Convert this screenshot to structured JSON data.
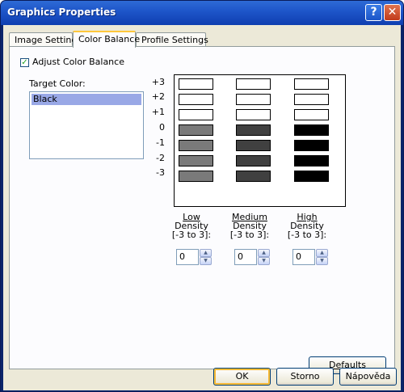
{
  "window": {
    "title": "Graphics Properties",
    "help_glyph": "?",
    "close_glyph": "✕"
  },
  "tabs": [
    {
      "label": "Image Settings"
    },
    {
      "label": "Color Balance"
    },
    {
      "label": "Profile Settings"
    }
  ],
  "adjust_checkbox": {
    "label": "Adjust Color Balance",
    "checked": true,
    "mark": "✓"
  },
  "target_color": {
    "label": "Target Color:",
    "items": [
      "Black"
    ],
    "selected": "Black"
  },
  "grid": {
    "row_labels": [
      "+3",
      "+2",
      "+1",
      "0",
      "-1",
      "-2",
      "-3"
    ],
    "columns": [
      {
        "header_line1": "Low",
        "header_line2": "Density",
        "header_line3": "[-3 to 3]:",
        "value": "0",
        "color": "#7a7a7a"
      },
      {
        "header_line1": "Medium",
        "header_line2": "Density",
        "header_line3": "[-3 to 3]:",
        "value": "0",
        "color": "#404040"
      },
      {
        "header_line1": "High",
        "header_line2": "Density",
        "header_line3": "[-3 to 3]:",
        "value": "0",
        "color": "#000000"
      }
    ],
    "spin_up": "▲",
    "spin_down": "▼"
  },
  "buttons": {
    "defaults": "Defaults",
    "ok": "OK",
    "cancel": "Storno",
    "help": "Nápověda"
  }
}
